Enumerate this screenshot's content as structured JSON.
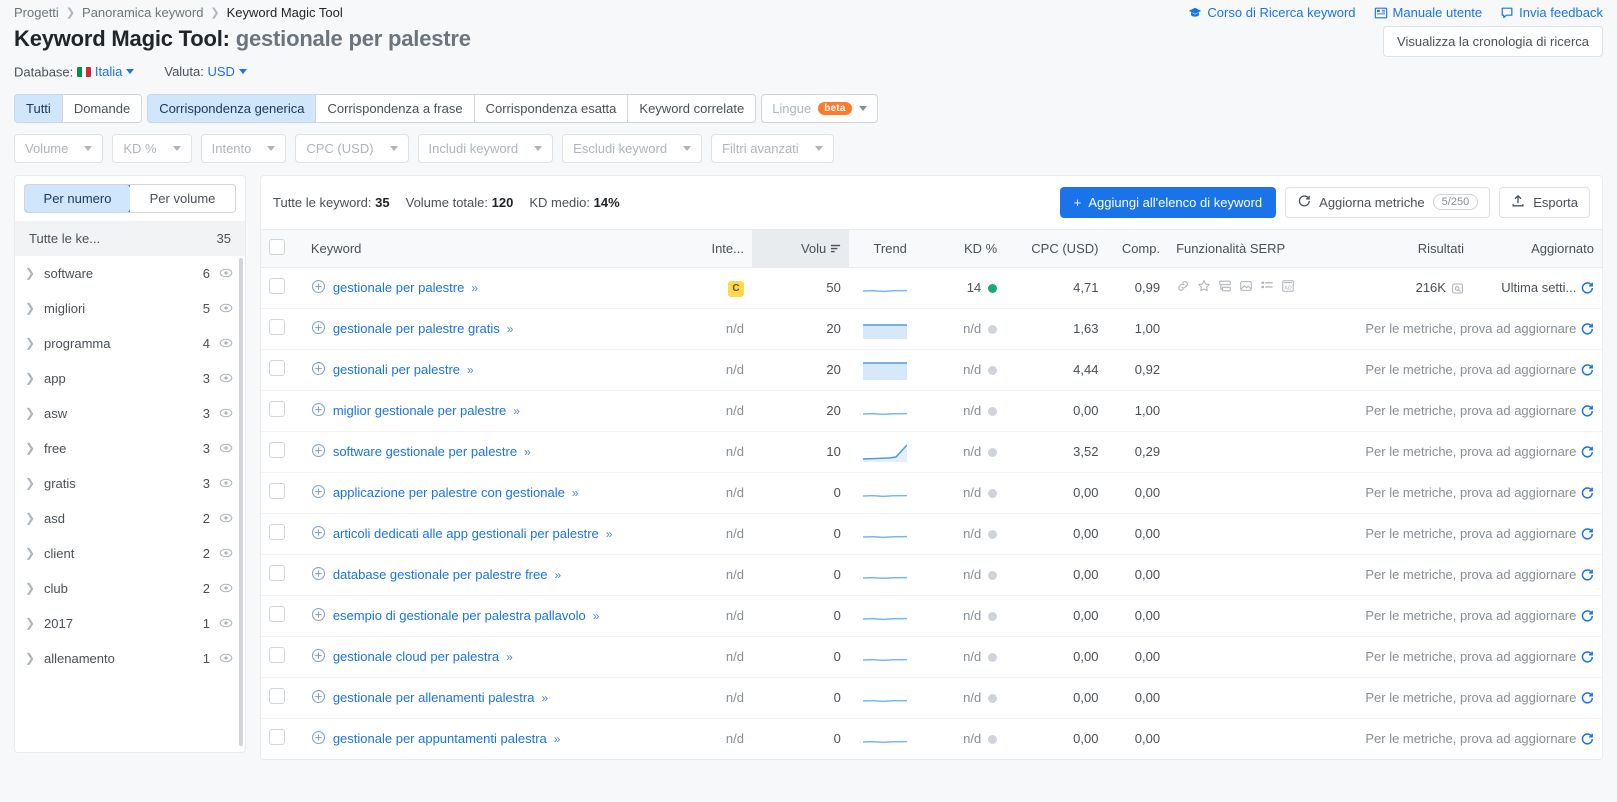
{
  "breadcrumb": {
    "items": [
      "Progetti",
      "Panoramica keyword",
      "Keyword Magic Tool"
    ]
  },
  "help_links": [
    {
      "label": "Corso di Ricerca keyword",
      "icon": "graduation-cap-icon"
    },
    {
      "label": "Manuale utente",
      "icon": "book-icon"
    },
    {
      "label": "Invia feedback",
      "icon": "speech-bubble-icon"
    }
  ],
  "page": {
    "title_prefix": "Keyword Magic Tool:",
    "title_keyword": "gestionale per palestre",
    "history_button": "Visualizza la cronologia di ricerca",
    "database_label": "Database:",
    "database_value": "Italia",
    "currency_label": "Valuta:",
    "currency_value": "USD"
  },
  "match_tabs": {
    "group1": [
      {
        "label": "Tutti",
        "active": true
      },
      {
        "label": "Domande",
        "active": false
      }
    ],
    "group2": [
      {
        "label": "Corrispondenza generica",
        "active": true
      },
      {
        "label": "Corrispondenza a frase",
        "active": false
      },
      {
        "label": "Corrispondenza esatta",
        "active": false
      },
      {
        "label": "Keyword correlate",
        "active": false
      }
    ],
    "languages": {
      "label": "Lingue",
      "badge": "beta"
    }
  },
  "filters": [
    {
      "label": "Volume"
    },
    {
      "label": "KD %"
    },
    {
      "label": "Intento"
    },
    {
      "label": "CPC (USD)"
    },
    {
      "label": "Includi keyword"
    },
    {
      "label": "Escludi keyword"
    },
    {
      "label": "Filtri avanzati"
    }
  ],
  "sidebar": {
    "sort_tabs": [
      {
        "label": "Per numero",
        "active": true
      },
      {
        "label": "Per volume",
        "active": false
      }
    ],
    "all_label": "Tutte le ke...",
    "all_count": "35",
    "groups": [
      {
        "label": "software",
        "count": "6"
      },
      {
        "label": "migliori",
        "count": "5"
      },
      {
        "label": "programma",
        "count": "4"
      },
      {
        "label": "app",
        "count": "3"
      },
      {
        "label": "asw",
        "count": "3"
      },
      {
        "label": "free",
        "count": "3"
      },
      {
        "label": "gratis",
        "count": "3"
      },
      {
        "label": "asd",
        "count": "2"
      },
      {
        "label": "client",
        "count": "2"
      },
      {
        "label": "club",
        "count": "2"
      },
      {
        "label": "2017",
        "count": "1"
      },
      {
        "label": "allenamento",
        "count": "1"
      }
    ]
  },
  "summary": {
    "keywords_label": "Tutte le keyword:",
    "keywords_value": "35",
    "volume_label": "Volume totale:",
    "volume_value": "120",
    "kd_label": "KD medio:",
    "kd_value": "14%"
  },
  "toolbar": {
    "add_label": "Aggiungi all'elenco di keyword",
    "refresh_label": "Aggiorna metriche",
    "refresh_count": "5/250",
    "export_label": "Esporta"
  },
  "table": {
    "columns": [
      "Keyword",
      "Inte...",
      "Volu",
      "Trend",
      "KD %",
      "CPC (USD)",
      "Comp.",
      "Funzionalità SERP",
      "Risultati",
      "Aggiornato"
    ],
    "update_hint": "Per le metriche, prova ad aggiornare",
    "rows": [
      {
        "keyword": "gestionale per palestre",
        "intent": "C",
        "volume": "50",
        "trend": "flat",
        "kd": "14",
        "kd_color": "#19a974",
        "cpc": "4,71",
        "comp": "0,99",
        "serp": [
          "link-icon",
          "star-icon",
          "sitelinks-icon",
          "image-icon",
          "list-icon",
          "ad-icon"
        ],
        "results": "216K",
        "updated": "Ultima setti..."
      },
      {
        "keyword": "gestionale per palestre gratis",
        "intent": "n/d",
        "volume": "20",
        "trend": "filled",
        "kd": "n/d",
        "cpc": "1,63",
        "comp": "1,00",
        "serp": [],
        "results": "",
        "updated": ""
      },
      {
        "keyword": "gestionali per palestre",
        "intent": "n/d",
        "volume": "20",
        "trend": "filled-high",
        "kd": "n/d",
        "cpc": "4,44",
        "comp": "0,92",
        "serp": [],
        "results": "",
        "updated": ""
      },
      {
        "keyword": "miglior gestionale per palestre",
        "intent": "n/d",
        "volume": "20",
        "trend": "flat",
        "kd": "n/d",
        "cpc": "0,00",
        "comp": "1,00",
        "serp": [],
        "results": "",
        "updated": ""
      },
      {
        "keyword": "software gestionale per palestre",
        "intent": "n/d",
        "volume": "10",
        "trend": "rising",
        "kd": "n/d",
        "cpc": "3,52",
        "comp": "0,29",
        "serp": [],
        "results": "",
        "updated": ""
      },
      {
        "keyword": "applicazione per palestre con gestionale",
        "intent": "n/d",
        "volume": "0",
        "trend": "flat",
        "kd": "n/d",
        "cpc": "0,00",
        "comp": "0,00",
        "serp": [],
        "results": "",
        "updated": ""
      },
      {
        "keyword": "articoli dedicati alle app gestionali per palestre",
        "intent": "n/d",
        "volume": "0",
        "trend": "flat",
        "kd": "n/d",
        "cpc": "0,00",
        "comp": "0,00",
        "serp": [],
        "results": "",
        "updated": ""
      },
      {
        "keyword": "database gestionale per palestre free",
        "intent": "n/d",
        "volume": "0",
        "trend": "flat",
        "kd": "n/d",
        "cpc": "0,00",
        "comp": "0,00",
        "serp": [],
        "results": "",
        "updated": ""
      },
      {
        "keyword": "esempio di gestionale per palestra pallavolo",
        "intent": "n/d",
        "volume": "0",
        "trend": "flat",
        "kd": "n/d",
        "cpc": "0,00",
        "comp": "0,00",
        "serp": [],
        "results": "",
        "updated": ""
      },
      {
        "keyword": "gestionale cloud per palestra",
        "intent": "n/d",
        "volume": "0",
        "trend": "flat",
        "kd": "n/d",
        "cpc": "0,00",
        "comp": "0,00",
        "serp": [],
        "results": "",
        "updated": ""
      },
      {
        "keyword": "gestionale per allenamenti palestra",
        "intent": "n/d",
        "volume": "0",
        "trend": "flat",
        "kd": "n/d",
        "cpc": "0,00",
        "comp": "0,00",
        "serp": [],
        "results": "",
        "updated": ""
      },
      {
        "keyword": "gestionale per appuntamenti palestra",
        "intent": "n/d",
        "volume": "0",
        "trend": "flat",
        "kd": "n/d",
        "cpc": "0,00",
        "comp": "0,00",
        "serp": [],
        "results": "",
        "updated": ""
      }
    ]
  },
  "colors": {
    "accent": "#1a73e8",
    "intent_commercial": "#ffd84d",
    "kd_easy": "#19a974"
  }
}
